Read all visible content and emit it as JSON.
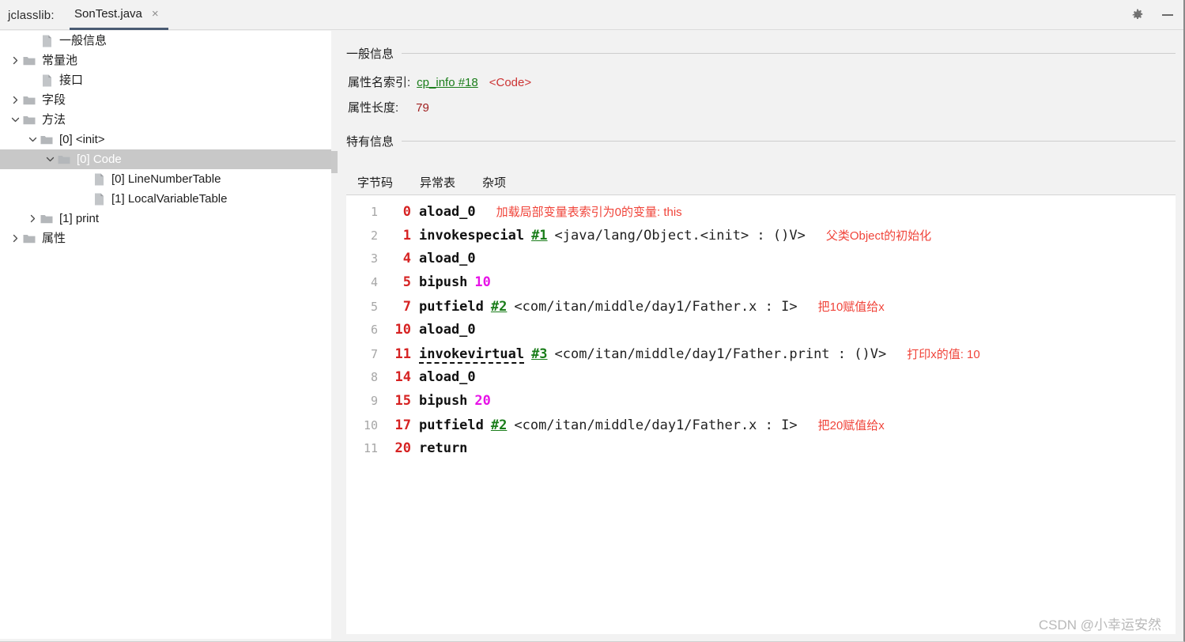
{
  "titlebar": {
    "app_label": "jclasslib:",
    "tab_title": "SonTest.java",
    "close_glyph": "×",
    "gear_icon": "gear-icon",
    "minimize_icon": "minimize-icon"
  },
  "tree": {
    "items": [
      {
        "label": "一般信息",
        "indent": 1,
        "twisty": "none",
        "icon": "file",
        "selected": false
      },
      {
        "label": "常量池",
        "indent": 0,
        "twisty": "collapsed",
        "icon": "folder",
        "selected": false
      },
      {
        "label": "接口",
        "indent": 1,
        "twisty": "none",
        "icon": "file",
        "selected": false
      },
      {
        "label": "字段",
        "indent": 0,
        "twisty": "collapsed",
        "icon": "folder",
        "selected": false
      },
      {
        "label": "方法",
        "indent": 0,
        "twisty": "expanded",
        "icon": "folder",
        "selected": false
      },
      {
        "label": "[0] <init>",
        "indent": 1,
        "twisty": "expanded",
        "icon": "folder",
        "selected": false
      },
      {
        "label": "[0] Code",
        "indent": 2,
        "twisty": "expanded",
        "icon": "folder",
        "selected": true
      },
      {
        "label": "[0] LineNumberTable",
        "indent": 4,
        "twisty": "none",
        "icon": "file",
        "selected": false
      },
      {
        "label": "[1] LocalVariableTable",
        "indent": 4,
        "twisty": "none",
        "icon": "file",
        "selected": false
      },
      {
        "label": "[1] print",
        "indent": 1,
        "twisty": "collapsed",
        "icon": "folder",
        "selected": false
      },
      {
        "label": "属性",
        "indent": 0,
        "twisty": "collapsed",
        "icon": "folder",
        "selected": false
      }
    ]
  },
  "detail": {
    "general_section_title": "一般信息",
    "specific_section_title": "特有信息",
    "attr_name_key": "属性名索引:",
    "attr_name_link": "cp_info #18",
    "attr_name_extra": "<Code>",
    "attr_len_key": "属性长度:",
    "attr_len_value": "79",
    "tabs": [
      {
        "label": "字节码",
        "active": true
      },
      {
        "label": "异常表",
        "active": false
      },
      {
        "label": "杂项",
        "active": false
      }
    ]
  },
  "bytecode": {
    "lines": [
      {
        "no": "1",
        "offset": "0",
        "opcode": "aload_0",
        "dashed": false,
        "cpref": "",
        "desc": "",
        "imm": "",
        "comment": "加载局部变量表索引为0的变量: this"
      },
      {
        "no": "2",
        "offset": "1",
        "opcode": "invokespecial",
        "dashed": false,
        "cpref": "#1",
        "desc": "<java/lang/Object.<init> : ()V>",
        "imm": "",
        "comment": "父类Object的初始化"
      },
      {
        "no": "3",
        "offset": "4",
        "opcode": "aload_0",
        "dashed": false,
        "cpref": "",
        "desc": "",
        "imm": "",
        "comment": ""
      },
      {
        "no": "4",
        "offset": "5",
        "opcode": "bipush",
        "dashed": false,
        "cpref": "",
        "desc": "",
        "imm": "10",
        "comment": ""
      },
      {
        "no": "5",
        "offset": "7",
        "opcode": "putfield",
        "dashed": false,
        "cpref": "#2",
        "desc": "<com/itan/middle/day1/Father.x : I>",
        "imm": "",
        "comment": "把10赋值给x"
      },
      {
        "no": "6",
        "offset": "10",
        "opcode": "aload_0",
        "dashed": false,
        "cpref": "",
        "desc": "",
        "imm": "",
        "comment": ""
      },
      {
        "no": "7",
        "offset": "11",
        "opcode": "invokevirtual",
        "dashed": true,
        "cpref": "#3",
        "desc": "<com/itan/middle/day1/Father.print : ()V>",
        "imm": "",
        "comment": "打印x的值: 10"
      },
      {
        "no": "8",
        "offset": "14",
        "opcode": "aload_0",
        "dashed": false,
        "cpref": "",
        "desc": "",
        "imm": "",
        "comment": ""
      },
      {
        "no": "9",
        "offset": "15",
        "opcode": "bipush",
        "dashed": false,
        "cpref": "",
        "desc": "",
        "imm": "20",
        "comment": ""
      },
      {
        "no": "10",
        "offset": "17",
        "opcode": "putfield",
        "dashed": false,
        "cpref": "#2",
        "desc": "<com/itan/middle/day1/Father.x : I>",
        "imm": "",
        "comment": "把20赋值给x"
      },
      {
        "no": "11",
        "offset": "20",
        "opcode": "return",
        "dashed": false,
        "cpref": "",
        "desc": "",
        "imm": "",
        "comment": ""
      }
    ]
  },
  "watermark": {
    "text": "CSDN @小幸运安然"
  },
  "colors": {
    "selection_bg": "#c8c8c8",
    "offset_red": "#d62222",
    "cpref_green": "#1a7d1a",
    "comment_red": "#f0443a",
    "immediate_magenta": "#e713e7",
    "tab_underline": "#4a5b73",
    "inner_tab_underline": "#9fadbf"
  }
}
